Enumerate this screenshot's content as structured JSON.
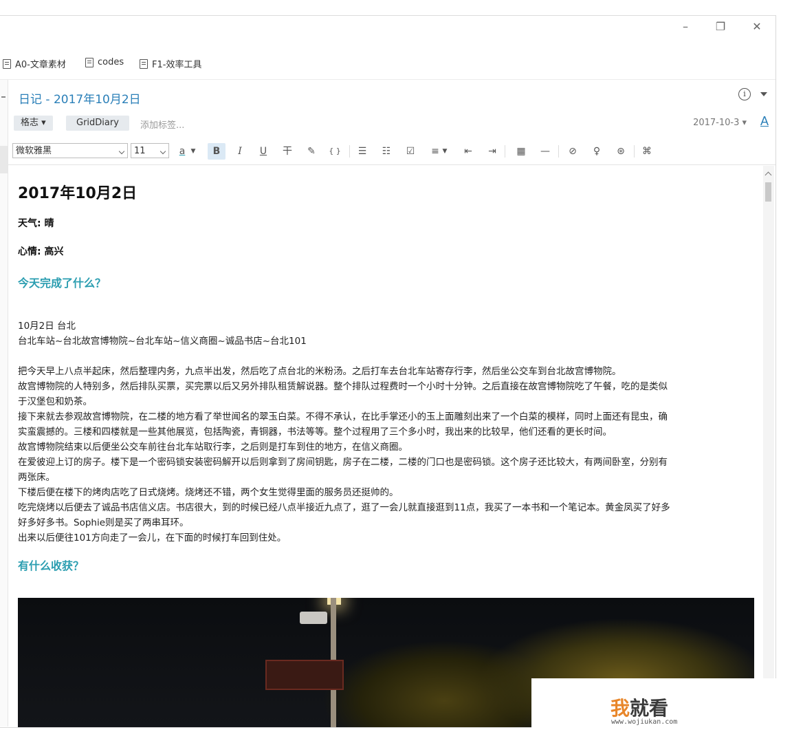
{
  "window": {
    "controls": {
      "minimize": "–",
      "restore": "❐",
      "close": "✕"
    }
  },
  "bookmarks": [
    {
      "label": "A0-文章素材"
    },
    {
      "label": "codes"
    },
    {
      "label": "F1-效率工具"
    }
  ],
  "note": {
    "title": "日记 - 2017年10月2日",
    "info_icon": "i",
    "tags": {
      "category": "格志 ▾",
      "template": "GridDiary",
      "add_placeholder": "添加标签...",
      "date": "2017-10-3 ▾",
      "font_button": "A"
    }
  },
  "toolbar": {
    "font_family": "微软雅黑",
    "font_size": "11",
    "text_color": "a",
    "bold": "B",
    "italic": "I",
    "underline": "U",
    "strikethrough": "干",
    "highlight": "✎",
    "code": "{ }",
    "bullet_list": "☰",
    "numbered_list": "☷",
    "checklist": "☑",
    "align": "≡",
    "outdent": "⇤",
    "indent": "⇥",
    "table": "▦",
    "hr": "—",
    "link": "⊘",
    "bulb": "♀",
    "emoji": "⊛",
    "more": "⌘"
  },
  "content": {
    "heading": "2017年10月2日",
    "weather": "天气: 晴",
    "mood": "心情: 高兴",
    "section1": "今天完成了什么？",
    "date_place": "10月2日 台北",
    "route": "台北车站~台北故宫博物院~台北车站~信义商圈~诚品书店~台北101",
    "body": [
      "把今天早上八点半起床，然后整理内务，九点半出发，然后吃了点台北的米粉汤。之后打车去台北车站寄存行李，然后坐公交车到台北故宫博物院。",
      "故宫博物院的人特别多，然后排队买票，买完票以后又另外排队租赁解说器。整个排队过程费时一个小时十分钟。之后直接在故宫博物院吃了午餐，吃的是类似",
      "于汉堡包和奶茶。",
      "接下来就去参观故宫博物院，在二楼的地方看了举世闻名的翠玉白菜。不得不承认，在比手掌还小的玉上面雕刻出来了一个白菜的模样，同时上面还有昆虫，确",
      "实蛮震撼的。三楼和四楼就是一些其他展览，包括陶瓷，青铜器，书法等等。整个过程用了三个多小时，我出来的比较早，他们还看的更长时间。",
      "故宫博物院结束以后便坐公交车前往台北车站取行李，之后则是打车到住的地方，在信义商圈。",
      "在爱彼迎上订的房子。楼下是一个密码锁安装密码解开以后则拿到了房间钥匙，房子在二楼，二楼的门口也是密码锁。这个房子还比较大，有两间卧室，分别有",
      "两张床。",
      "下楼后便在楼下的烤肉店吃了日式烧烤。烧烤还不错，两个女生觉得里面的服务员还挺帅的。",
      "吃完烧烤以后便去了诚品书店信义店。书店很大，到的时候已经八点半接近九点了，逛了一会儿就直接逛到11点，我买了一本书和一个笔记本。黄金凤买了好多",
      "好多好多书。Sophie则是买了两串耳环。",
      "出来以后便往101方向走了一会儿，在下面的时候打车回到住处。"
    ],
    "section2": "有什么收获？"
  },
  "watermark": {
    "first_char": "我",
    "rest": "就看",
    "url": "www.wojiukan.com"
  }
}
